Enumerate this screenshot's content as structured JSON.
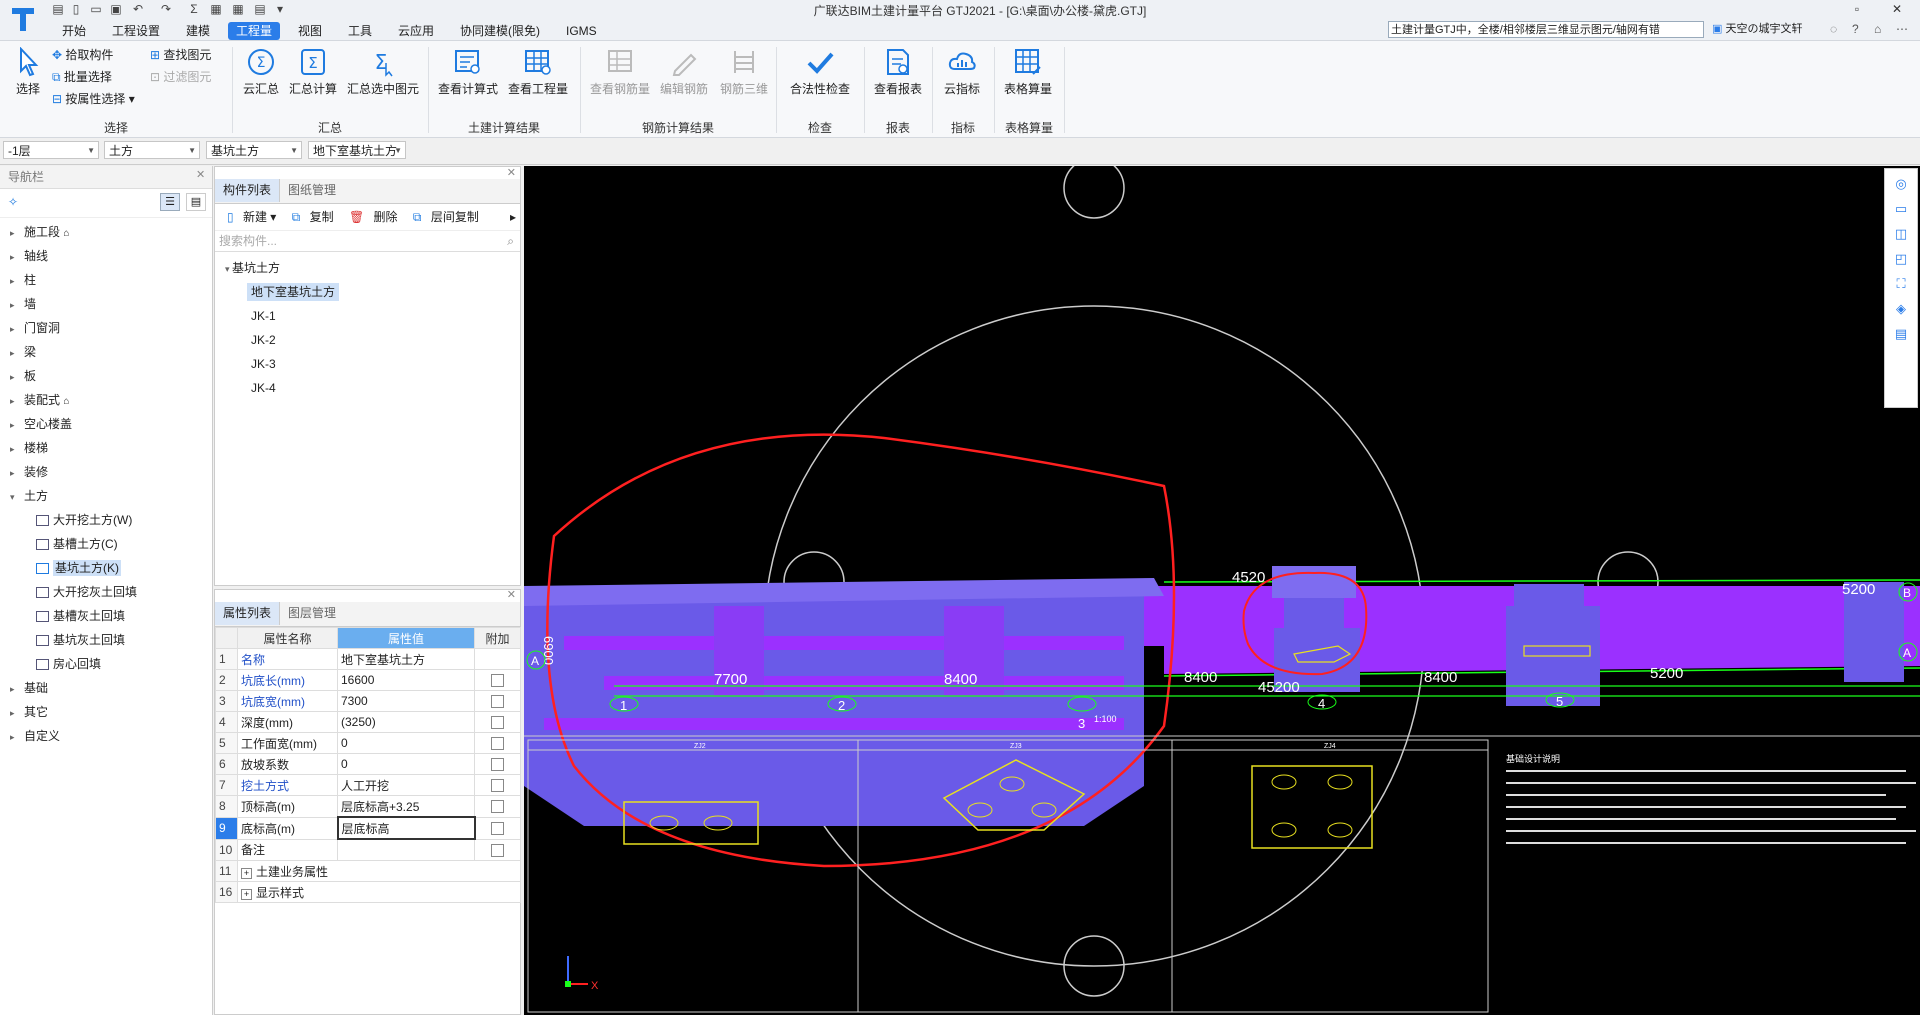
{
  "app": {
    "title": "广联达BIM土建计量平台 GTJ2021 - [G:\\桌面\\办公楼-黛虎.GTJ]",
    "notice": "土建计量GTJ中，全楼/相邻楼层三维显示图元/轴网有错",
    "user": "天空の城宇文轩"
  },
  "menu": [
    "开始",
    "工程设置",
    "建模",
    "工程量",
    "视图",
    "工具",
    "云应用",
    "协同建模(限免)",
    "IGMS"
  ],
  "active_menu": "工程量",
  "ribbon": {
    "select_group": {
      "name": "选择",
      "big": "选择",
      "small": [
        "拾取构件",
        "批量选择",
        "按属性选择",
        "查找图元",
        "过滤图元"
      ]
    },
    "sum_group": {
      "name": "汇总",
      "buttons": [
        "云汇总",
        "汇总计算",
        "汇总选中图元"
      ]
    },
    "civil_group": {
      "name": "土建计算结果",
      "buttons": [
        "查看计算式",
        "查看工程量"
      ]
    },
    "rebar_group": {
      "name": "钢筋计算结果",
      "buttons": [
        "查看钢筋量",
        "编辑钢筋",
        "钢筋三维"
      ]
    },
    "check_group": {
      "name": "检查",
      "buttons": [
        "合法性检查"
      ]
    },
    "report_group": {
      "name": "报表",
      "buttons": [
        "查看报表"
      ]
    },
    "index_group": {
      "name": "指标",
      "buttons": [
        "云指标"
      ]
    },
    "table_group": {
      "name": "表格算量",
      "buttons": [
        "表格算量"
      ]
    }
  },
  "selectors": [
    "-1层",
    "土方",
    "基坑土方",
    "地下室基坑土方"
  ],
  "nav": {
    "title": "导航栏",
    "items": [
      "施工段",
      "轴线",
      "柱",
      "墙",
      "门窗洞",
      "梁",
      "板",
      "装配式",
      "空心楼盖",
      "楼梯",
      "装修",
      "土方",
      "大开挖土方(W)",
      "基槽土方(C)",
      "基坑土方(K)",
      "大开挖灰土回填",
      "基槽灰土回填",
      "基坑灰土回填",
      "房心回填",
      "基础",
      "其它",
      "自定义"
    ]
  },
  "complist": {
    "tabs": [
      "构件列表",
      "图纸管理"
    ],
    "tools": [
      "新建",
      "复制",
      "删除",
      "层间复制"
    ],
    "search_placeholder": "搜索构件...",
    "group": "基坑土方",
    "items": [
      "地下室基坑土方",
      "JK-1",
      "JK-2",
      "JK-3",
      "JK-4"
    ]
  },
  "props": {
    "tabs": [
      "属性列表",
      "图层管理"
    ],
    "headers": [
      "属性名称",
      "属性值",
      "附加"
    ],
    "rows": [
      {
        "n": "1",
        "name": "名称",
        "value": "地下室基坑土方"
      },
      {
        "n": "2",
        "name": "坑底长(mm)",
        "value": "16600"
      },
      {
        "n": "3",
        "name": "坑底宽(mm)",
        "value": "7300"
      },
      {
        "n": "4",
        "name": "深度(mm)",
        "value": "(3250)"
      },
      {
        "n": "5",
        "name": "工作面宽(mm)",
        "value": "0"
      },
      {
        "n": "6",
        "name": "放坡系数",
        "value": "0"
      },
      {
        "n": "7",
        "name": "挖土方式",
        "value": "人工开挖"
      },
      {
        "n": "8",
        "name": "顶标高(m)",
        "value": "层底标高+3.25"
      },
      {
        "n": "9",
        "name": "底标高(m)",
        "value": "层底标高"
      },
      {
        "n": "10",
        "name": "备注",
        "value": ""
      },
      {
        "n": "11",
        "name": "土建业务属性",
        "value": ""
      },
      {
        "n": "16",
        "name": "显示样式",
        "value": ""
      }
    ]
  },
  "viewport": {
    "dims_left": [
      "7700",
      "8400"
    ],
    "dims_right": [
      "8400",
      "45200",
      "8400",
      "5200"
    ],
    "top_dims": [
      "4520",
      "5200"
    ],
    "axis_labels": [
      "1",
      "2",
      "3",
      "4",
      "5",
      "A",
      "B"
    ],
    "left_dim": "6900",
    "scale_note": "1:100",
    "design_title": "基础设计说明",
    "table_heads": [
      "ZJ2",
      "ZJ3",
      "ZJ4"
    ],
    "colors": {
      "purple": "#9b30ff",
      "blue": "#6a5ae8",
      "red": "#ff2020",
      "green": "#19ff19",
      "yellow": "#e8e020"
    }
  }
}
